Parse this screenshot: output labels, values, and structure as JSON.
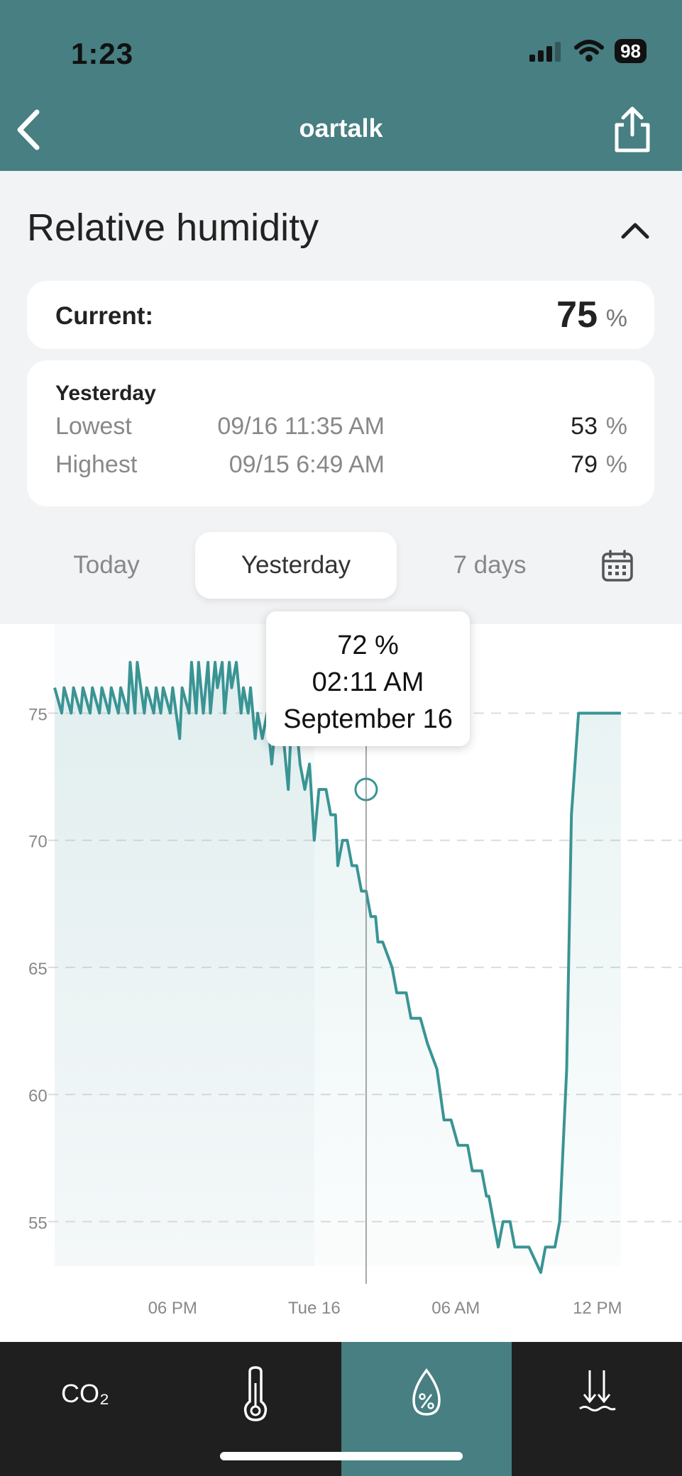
{
  "status": {
    "time": "1:23",
    "battery": "98"
  },
  "header": {
    "title": "oartalk"
  },
  "section": {
    "title": "Relative humidity"
  },
  "current": {
    "label": "Current:",
    "value": "75",
    "unit": "%"
  },
  "stats": {
    "title": "Yesterday",
    "rows": [
      {
        "label": "Lowest",
        "date": "09/16 11:35 AM",
        "value": "53",
        "unit": "%"
      },
      {
        "label": "Highest",
        "date": "09/15 6:49 AM",
        "value": "79",
        "unit": "%"
      }
    ]
  },
  "tabs": [
    {
      "label": "Today",
      "active": false
    },
    {
      "label": "Yesterday",
      "active": true
    },
    {
      "label": "7 days",
      "active": false
    }
  ],
  "tooltip": {
    "value": "72 %",
    "time": "02:11 AM",
    "date": "September 16"
  },
  "colors": {
    "accent": "#477f82",
    "line": "#3a9494",
    "nav_bg": "#1f1f1f"
  },
  "nav": [
    {
      "label": "CO₂",
      "icon": "co2-icon"
    },
    {
      "label": "",
      "icon": "thermometer-icon"
    },
    {
      "label": "",
      "icon": "humidity-drop-icon",
      "active": true
    },
    {
      "label": "",
      "icon": "pressure-icon"
    }
  ],
  "chart_data": {
    "type": "line",
    "xlabel": "",
    "ylabel": "",
    "ylim": [
      52.5,
      78.5
    ],
    "yticks": [
      55,
      60,
      65,
      70,
      75
    ],
    "ytick_labels": [
      "55",
      "60",
      "65",
      "70",
      "75"
    ],
    "xtick_labels": [
      "06 PM",
      "Tue 16",
      "06 AM",
      "12 PM"
    ],
    "xtick_hours": [
      18,
      24,
      30,
      36
    ],
    "xlim_hours": [
      13,
      37.3
    ],
    "grid": true,
    "cursor_hour": 26.2,
    "cursor_value": 72,
    "series": [
      {
        "x_hours": [
          13.0,
          13.3,
          13.4,
          13.7,
          13.8,
          14.1,
          14.2,
          14.5,
          14.6,
          14.9,
          15.0,
          15.3,
          15.4,
          15.7,
          15.8,
          16.1,
          16.2,
          16.4,
          16.5,
          16.8,
          16.9,
          17.2,
          17.3,
          17.5,
          17.6,
          17.9,
          18.0,
          18.3,
          18.4,
          18.7,
          18.8,
          19.0,
          19.1,
          19.3,
          19.5,
          19.6,
          19.8,
          19.9,
          20.1,
          20.2,
          20.4,
          20.5,
          20.7,
          20.9,
          21.0,
          21.2,
          21.3,
          21.5,
          21.6,
          21.8,
          22.0,
          22.2,
          22.4,
          22.5,
          22.7,
          22.9,
          23.0,
          23.3,
          23.4,
          23.6,
          23.8,
          24.0,
          24.2,
          24.5,
          24.7,
          24.9,
          25.0,
          25.2,
          25.4,
          25.6,
          25.8,
          26.0,
          26.2,
          26.4,
          26.6,
          26.7,
          26.9,
          27.3,
          27.5,
          27.9,
          28.1,
          28.5,
          28.8,
          29.2,
          29.5,
          29.8,
          30.1,
          30.5,
          30.7,
          31.1,
          31.3,
          31.4,
          31.8,
          32.0,
          32.3,
          32.5,
          32.9,
          33.1,
          33.6,
          33.8,
          34.1,
          34.2,
          34.4,
          34.7,
          34.9,
          35.2,
          35.3,
          35.8,
          35.9,
          36.1,
          36.3,
          36.5,
          36.6,
          36.8,
          37.0
        ],
        "values": [
          76,
          75,
          76,
          75,
          76,
          75,
          76,
          75,
          76,
          75,
          76,
          75,
          76,
          75,
          76,
          75,
          77,
          75,
          77,
          75,
          76,
          75,
          76,
          75,
          76,
          75,
          76,
          74,
          76,
          75,
          77,
          75,
          77,
          75,
          77,
          75,
          77,
          76,
          77,
          75,
          77,
          76,
          77,
          75,
          76,
          75,
          76,
          74,
          75,
          74,
          75,
          73,
          75,
          74,
          74,
          72,
          74,
          74,
          73,
          72,
          73,
          70,
          72,
          72,
          71,
          71,
          69,
          70,
          70,
          69,
          69,
          68,
          68,
          67,
          67,
          66,
          66,
          65,
          64,
          64,
          63,
          63,
          62,
          61,
          59,
          59,
          58,
          58,
          57,
          57,
          56,
          56,
          54,
          55,
          55,
          54,
          54,
          54,
          53,
          54,
          54,
          54,
          55,
          61,
          71,
          75,
          75,
          75,
          75,
          75,
          75,
          75,
          75,
          75,
          75,
          75,
          75,
          75,
          75
        ]
      }
    ]
  }
}
